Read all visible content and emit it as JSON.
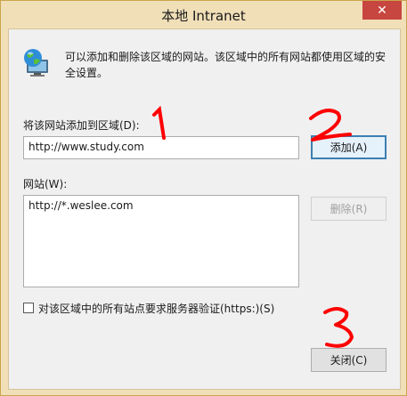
{
  "window": {
    "title": "本地 Intranet",
    "close_glyph": "✕"
  },
  "description": "可以添加和删除该区域的网站。该区域中的所有网站都使用区域的安全设置。",
  "add_zone": {
    "label": "将该网站添加到区域(D):",
    "value": "http://www.study.com",
    "add_button": "添加(A)"
  },
  "sites": {
    "label": "网站(W):",
    "items": [
      "http://*.weslee.com"
    ],
    "remove_button": "删除(R)"
  },
  "https_checkbox": {
    "label": "对该区域中的所有站点要求服务器验证(https:)(S)",
    "checked": false
  },
  "close_button": "关闭(C)",
  "annotations": [
    "1",
    "2",
    "3"
  ],
  "colors": {
    "title_bar": "#f1dfb8",
    "close_red": "#c7463f",
    "annotation_red": "#ff0000",
    "focus_blue": "#3c7fb1"
  },
  "icons": {
    "zone": "globe-monitor-icon"
  }
}
